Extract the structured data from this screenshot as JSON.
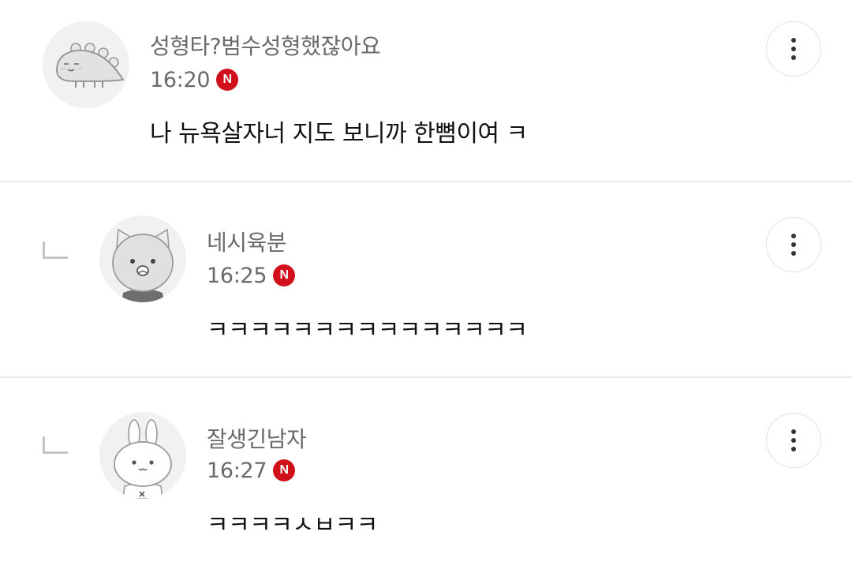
{
  "comments": [
    {
      "nickname": "성형타?범수성형했잖아요",
      "time": "16:20",
      "badge": "N",
      "text": "나 뉴욕살자너 지도 보니까 한뼘이여 ㅋ",
      "avatar": "dinosaur-avatar",
      "is_reply": false
    },
    {
      "nickname": "네시육분",
      "time": "16:25",
      "badge": "N",
      "text": "ㅋㅋㅋㅋㅋㅋㅋㅋㅋㅋㅋㅋㅋㅋㅋ",
      "avatar": "cat-avatar",
      "is_reply": true
    },
    {
      "nickname": "잘생긴남자",
      "time": "16:27",
      "badge": "N",
      "text": "ㅋㅋㅋㅋㅅㅂㅋㅋ",
      "avatar": "rabbit-avatar",
      "is_reply": true
    }
  ],
  "colors": {
    "badge": "#d0101b",
    "nickname": "#6a6a6a",
    "divider": "#e6e6e6",
    "avatar_bg": "#f1f1f1"
  },
  "icons": {
    "reply": "reply-arrow-icon",
    "more": "more-vertical-icon"
  }
}
